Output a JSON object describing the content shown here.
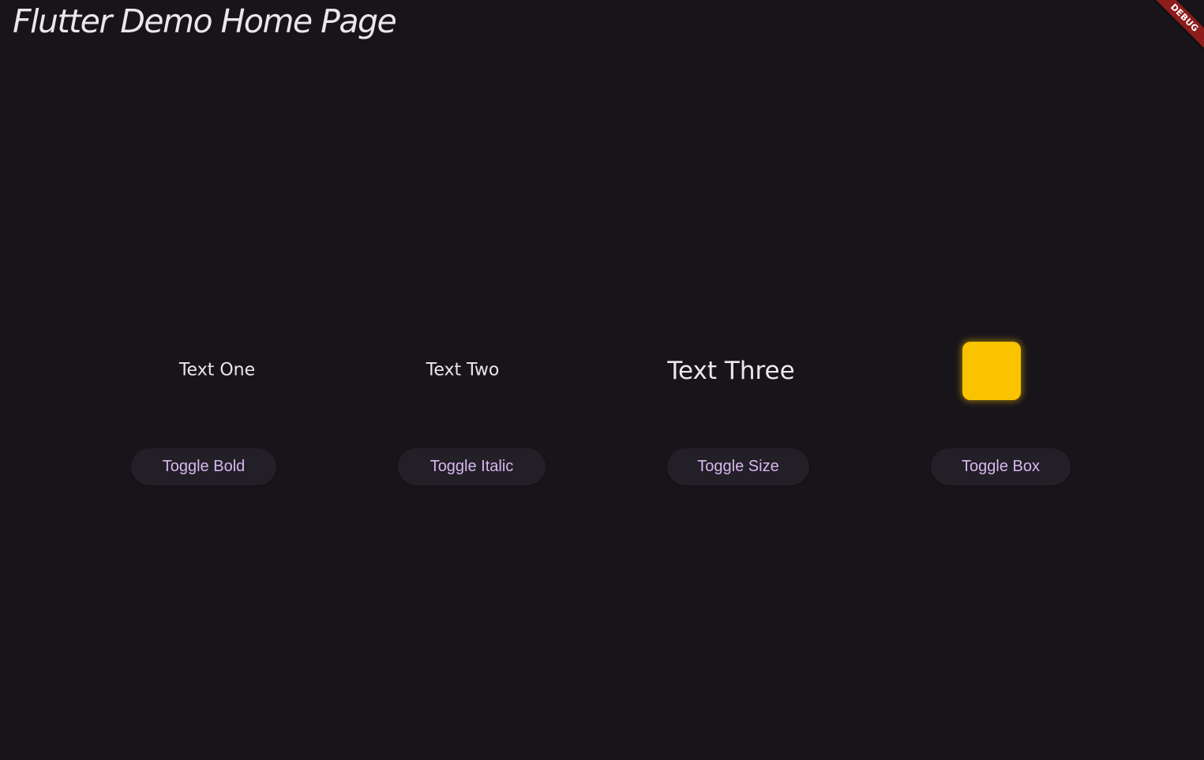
{
  "app_bar": {
    "title": "Flutter Demo Home Page"
  },
  "debug_banner": {
    "label": "DEBUG",
    "color": "#8e1c1c"
  },
  "texts": {
    "one": "Text One",
    "two": "Text Two",
    "three": "Text Three"
  },
  "box": {
    "color": "#f9c300",
    "visible": true
  },
  "buttons": {
    "bold": "Toggle Bold",
    "italic": "Toggle Italic",
    "size": "Toggle Size",
    "box": "Toggle Box"
  },
  "colors": {
    "background": "#18151a",
    "button_background": "#231f27",
    "button_text": "#d9b7f0",
    "text": "#ece6ee"
  }
}
